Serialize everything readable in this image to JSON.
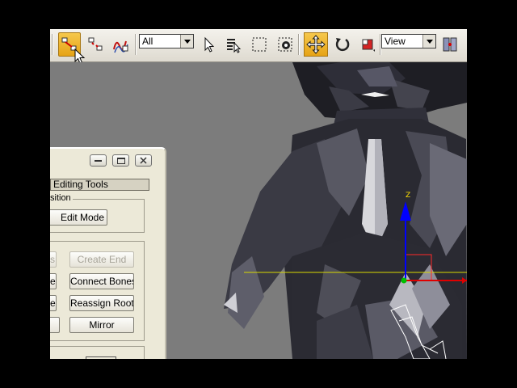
{
  "toolbar": {
    "selection_filter": {
      "value": "All"
    },
    "reference_coordinate": {
      "value": "View"
    }
  },
  "dialog": {
    "rollout_title": "Editing Tools",
    "position_group_label": "sition",
    "edit_mode_label": "Edit Mode",
    "buttons": {
      "row1_left": "s",
      "create_end": "Create End",
      "row2_left": "e",
      "connect_bones": "Connect Bones",
      "row3_left": "e",
      "reassign_root": "Reassign Root",
      "mirror": "Mirror"
    }
  },
  "viewport": {
    "gizmo_axis_label": "Z",
    "colors": {
      "x_axis": "#e00000",
      "y_axis": "#00c000",
      "z_axis": "#0000ff",
      "grid_line": "#d8d800"
    }
  }
}
